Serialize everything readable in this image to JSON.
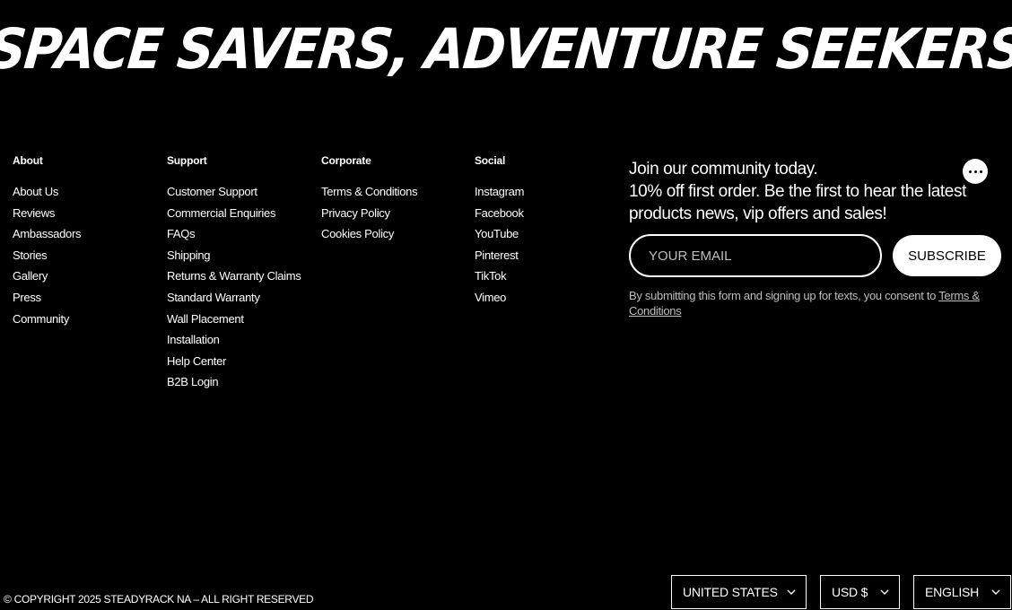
{
  "hero": {
    "title": "SPACE SAVERS, ADVENTURE SEEKERS"
  },
  "columns": [
    {
      "heading": "About",
      "items": [
        "About Us",
        "Reviews",
        "Ambassadors",
        "Stories",
        "Gallery",
        "Press",
        "Community"
      ]
    },
    {
      "heading": "Support",
      "items": [
        "Customer Support",
        "Commercial Enquiries",
        "FAQs",
        "Shipping",
        "Returns & Warranty Claims",
        "Standard Warranty",
        "Wall Placement",
        "Installation",
        "Help Center",
        "B2B Login"
      ]
    },
    {
      "heading": "Corporate",
      "items": [
        "Terms & Conditions",
        "Privacy Policy",
        "Cookies Policy"
      ]
    },
    {
      "heading": "Social",
      "items": [
        "Instagram",
        "Facebook",
        "YouTube",
        "Pinterest",
        "TikTok",
        "Vimeo"
      ]
    }
  ],
  "newsletter": {
    "heading": "Join our community today.",
    "text": "10% off first order. Be the first to hear the latest products news, vip offers and sales!",
    "email_placeholder": "YOUR EMAIL",
    "subscribe_label": "SUBSCRIBE",
    "consent_text": "By submitting this form and signing up for texts, you consent to ",
    "consent_link": "Terms & Conditions"
  },
  "footer": {
    "copyright": "© COPYRIGHT 2025 STEADYRACK NA – ALL RIGHT RESERVED",
    "country": "UNITED STATES",
    "currency": "USD $",
    "language": "ENGLISH"
  },
  "icons": {
    "chat": "chat-bubble-icon",
    "chevron": "chevron-down-icon"
  },
  "colors": {
    "background": "#000000",
    "text": "#ffffff",
    "muted": "#bdbdbd"
  }
}
